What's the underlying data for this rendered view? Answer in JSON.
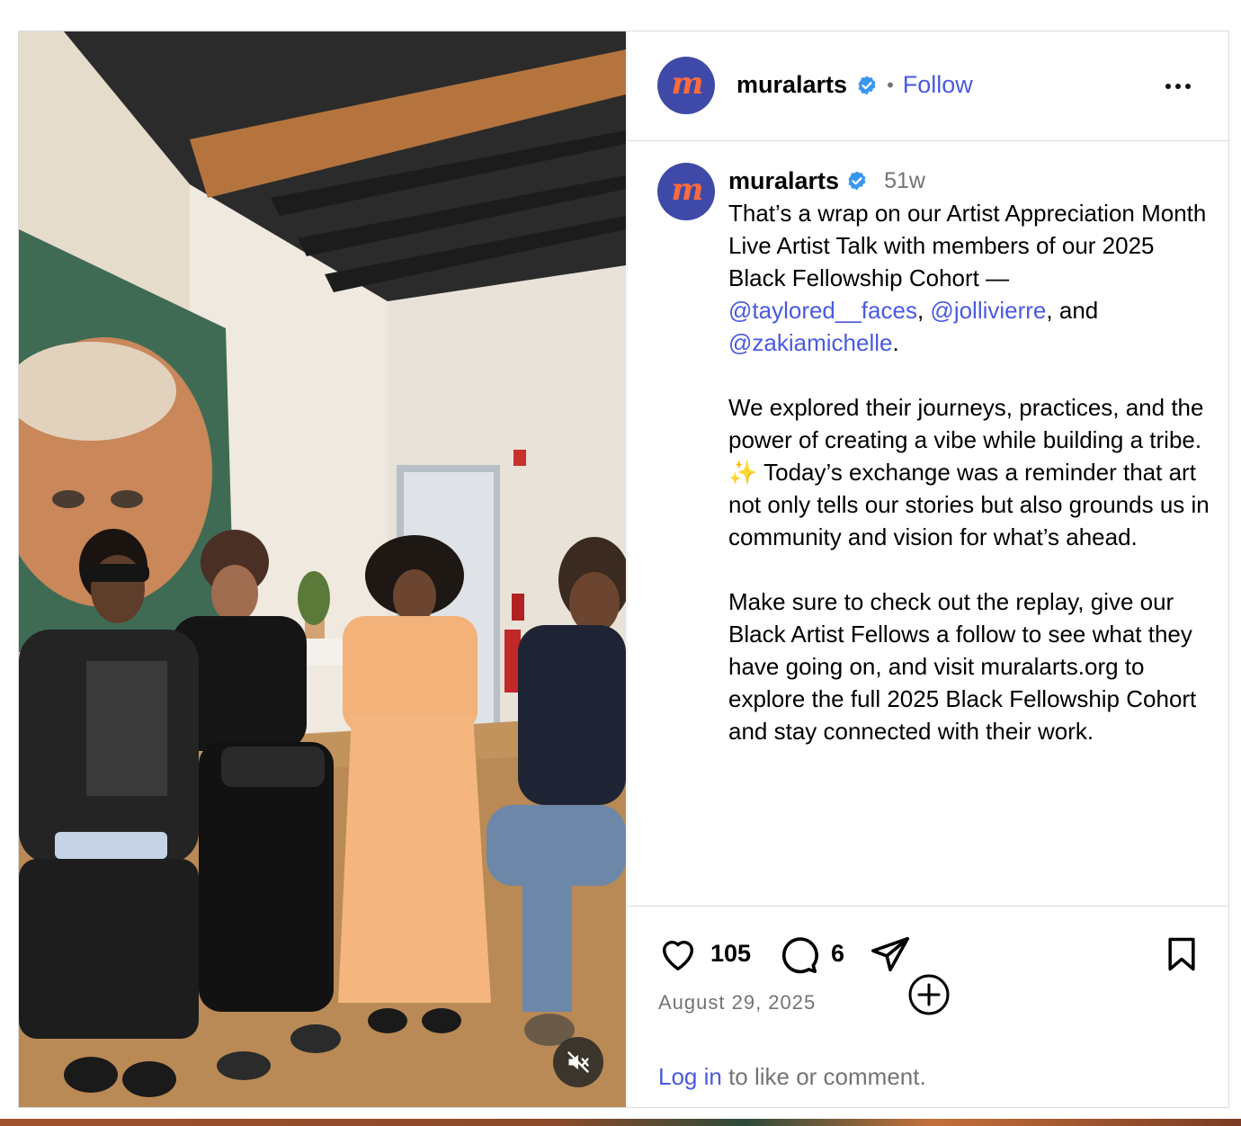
{
  "post": {
    "account": {
      "username": "muralarts",
      "avatar_letter": "m",
      "verified": true
    },
    "header": {
      "separator": "•",
      "follow_label": "Follow",
      "more_icon": "more-horizontal-icon"
    },
    "caption": {
      "username": "muralarts",
      "age": "51w",
      "paragraph1": {
        "text": "That’s a wrap on our Artist Appreciation Month Live Artist Talk with members of our 2025 Black Fellowship Cohort —",
        "mention1": "@taylored__faces",
        "sep1": ", ",
        "mention2": "@jollivierre",
        "sep2": ", and",
        "mention3": "@zakiamichelle",
        "end": "."
      },
      "paragraph2": "We explored their journeys, practices, and the power of creating a vibe while building a tribe. ✨ Today’s exchange was a reminder that art not only tells our stories but also grounds us in community and vision for what’s ahead.",
      "paragraph3": "Make sure to check out the replay, give our Black Artist Fellows a follow to see what they have going on, and visit muralarts.org to explore the full 2025 Black Fellowship Cohort and stay connected with their work."
    },
    "actions": {
      "likes": "105",
      "comments": "6",
      "date": "August 29, 2025",
      "login_link": "Log in",
      "login_rest": " to like or comment."
    },
    "media": {
      "type": "video",
      "muted": true
    },
    "colors": {
      "link": "#4a5ae0",
      "avatar_bg": "#3f4aa8",
      "avatar_letter": "#ff6b3d",
      "verified": "#3897f0",
      "muted_text": "#737373"
    }
  }
}
